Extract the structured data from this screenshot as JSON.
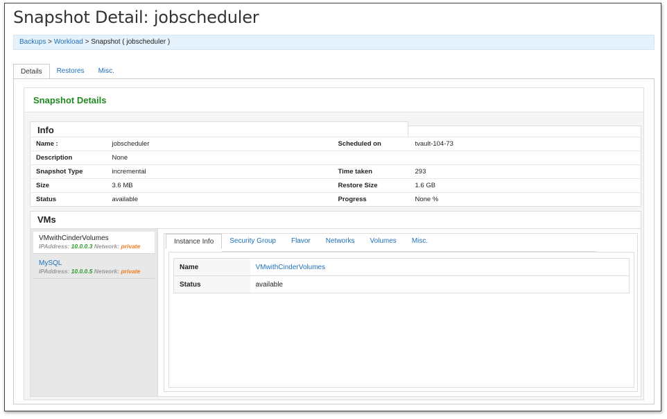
{
  "page": {
    "title": "Snapshot Detail: jobscheduler"
  },
  "breadcrumb": {
    "items": [
      "Backups",
      "Workload"
    ],
    "separator": ">",
    "current": "Snapshot ( jobscheduler )"
  },
  "tabs": [
    {
      "label": "Details",
      "active": true
    },
    {
      "label": "Restores",
      "active": false
    },
    {
      "label": "Misc.",
      "active": false
    }
  ],
  "snapshot_details": {
    "heading": "Snapshot Details",
    "info": {
      "heading": "Info",
      "rows": [
        {
          "label": "Name :",
          "value": "jobscheduler",
          "label2": "Scheduled on",
          "value2": "tvault-104-73"
        },
        {
          "label": "Description",
          "value": "None",
          "label2": "",
          "value2": ""
        },
        {
          "label": "Snapshot Type",
          "value": "incremental",
          "label2": "Time taken",
          "value2": "293"
        },
        {
          "label": "Size",
          "value": "3.6 MB",
          "label2": "Restore Size",
          "value2": "1.6 GB"
        },
        {
          "label": "Status",
          "value": "available",
          "label2": "Progress",
          "value2": "None %"
        }
      ]
    },
    "vms": {
      "heading": "VMs",
      "list": [
        {
          "name": "VMwithCinderVolumes",
          "ip_label": "IPAddress:",
          "ip": "10.0.0.3",
          "net_label": "Network:",
          "network": "private",
          "active": true
        },
        {
          "name": "MySQL",
          "ip_label": "IPAddress:",
          "ip": "10.0.0.5",
          "net_label": "Network:",
          "network": "private",
          "active": false
        }
      ],
      "detail_tabs": [
        {
          "label": "Instance Info",
          "active": true
        },
        {
          "label": "Security Group",
          "active": false
        },
        {
          "label": "Flavor",
          "active": false
        },
        {
          "label": "Networks",
          "active": false
        },
        {
          "label": "Volumes",
          "active": false
        },
        {
          "label": "Misc.",
          "active": false
        }
      ],
      "instance_info": {
        "name_label": "Name",
        "name_value": "VMwithCinderVolumes",
        "status_label": "Status",
        "status_value": "available"
      }
    }
  },
  "colors": {
    "link": "#1d6fb8",
    "heading_green": "#1e8a1e",
    "ip_green": "#2a9a2a",
    "network_orange": "#f07b22",
    "breadcrumb_bg": "#e6f2fb"
  }
}
